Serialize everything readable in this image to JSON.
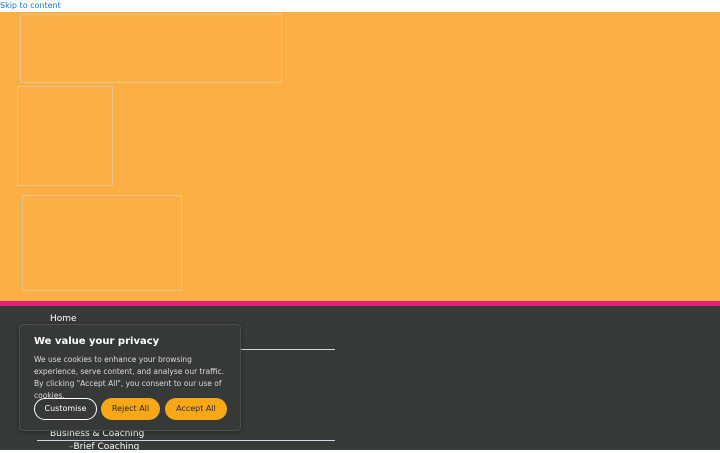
{
  "skip_link": {
    "label": "Skip to content"
  },
  "colors": {
    "hero": "#fbaf45",
    "accent_strip": "#e51d78",
    "footer": "#363a38",
    "button_accent": "#f8a716"
  },
  "footer_nav": {
    "home": "Home",
    "business_coaching": "Business & Coaching",
    "sub_prefix": "–",
    "brief_coaching": "Brief Coaching"
  },
  "cookie_banner": {
    "title": "We value your privacy",
    "body": "We use cookies to enhance your browsing experience, serve content, and analyse our traffic. By clicking \"Accept All\", you consent to our use of cookies.",
    "customise_label": "Customise",
    "reject_label": "Reject All",
    "accept_label": "Accept All"
  }
}
